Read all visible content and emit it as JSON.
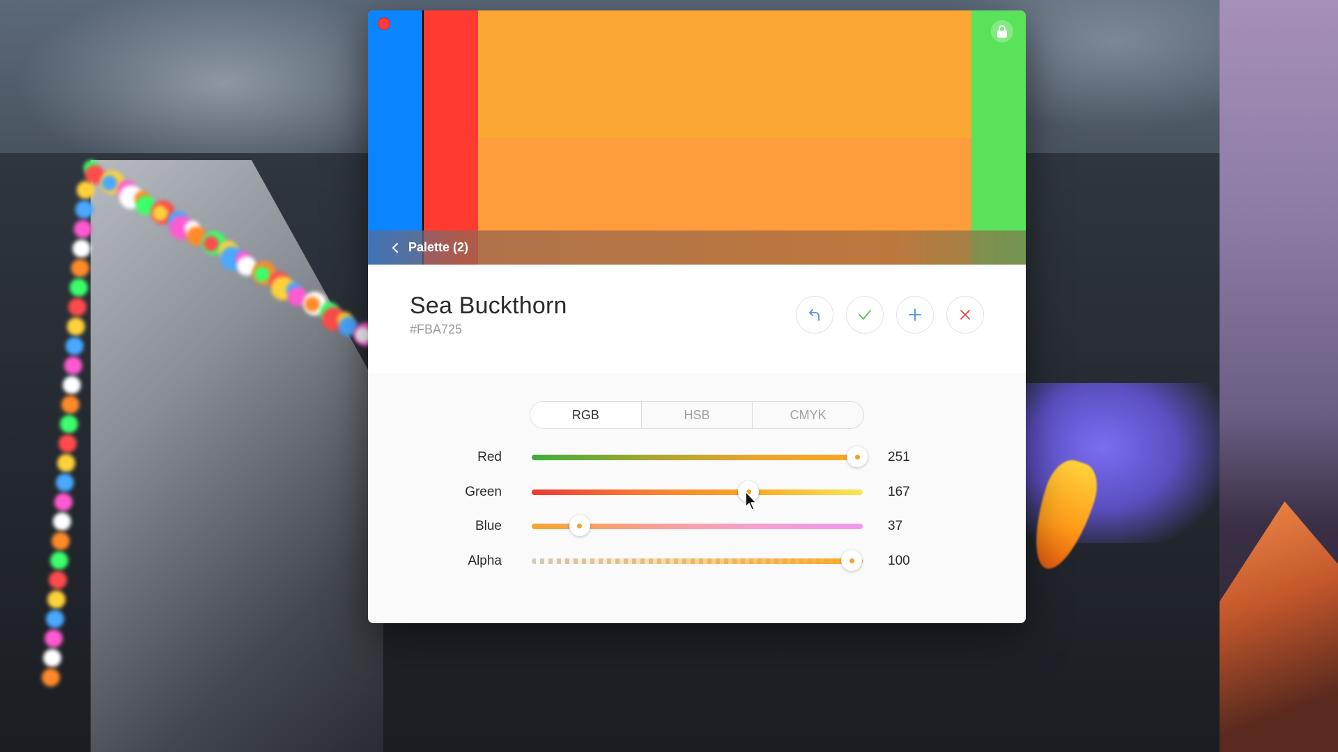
{
  "window": {
    "palette_swatches": [
      {
        "color": "#0A84FF"
      },
      {
        "color": "#FF3B30"
      },
      {
        "color_top": "#FBA733",
        "color_bottom": "#FF9C3C"
      },
      {
        "color": "#5AE35A"
      }
    ],
    "close_dot_color": "#FC3B3B",
    "lock_icon": "lock-icon"
  },
  "nav": {
    "back_label": "Palette (2)",
    "back_icon": "chevron-left-icon"
  },
  "color": {
    "name": "Sea Buckthorn",
    "hex": "#FBA725"
  },
  "actions": [
    {
      "name": "undo",
      "icon": "undo-icon",
      "color": "#4A90E2"
    },
    {
      "name": "confirm",
      "icon": "check-icon",
      "color": "#5BC25B"
    },
    {
      "name": "add",
      "icon": "plus-icon",
      "color": "#4A90E2"
    },
    {
      "name": "delete",
      "icon": "close-icon",
      "color": "#E8413C"
    }
  ],
  "mode_tabs": {
    "selected": "RGB",
    "items": [
      "RGB",
      "HSB",
      "CMYK"
    ]
  },
  "sliders": [
    {
      "label": "Red",
      "value": "251",
      "level": 0.984,
      "gradient": "linear-gradient(90deg,#3cae3a,#a0a632,#e9a52c,#fba725)"
    },
    {
      "label": "Green",
      "value": "167",
      "level": 0.655,
      "gradient": "linear-gradient(90deg,#ea3a35,#f67d33,#fba725,#f5e85a)"
    },
    {
      "label": "Blue",
      "value": "37",
      "level": 0.145,
      "gradient": "linear-gradient(90deg,#f7a52e,#f6a08c,#f59fd0,#f199ee)"
    },
    {
      "label": "Alpha",
      "value": "100",
      "level": 1.0,
      "gradient": "linear-gradient(90deg,rgba(251,167,37,0.05),rgba(251,167,37,1))"
    }
  ]
}
